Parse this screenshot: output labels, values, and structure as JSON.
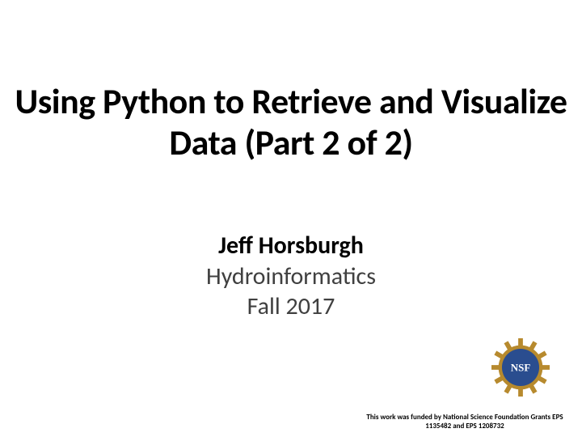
{
  "title": "Using Python to Retrieve and Visualize Data (Part 2 of 2)",
  "author": "Jeff Horsburgh",
  "course": "Hydroinformatics",
  "term": "Fall 2017",
  "funding_note": "This work was funded by National Science Foundation Grants EPS 1135482 and EPS 1208732",
  "logo_name": "NSF"
}
